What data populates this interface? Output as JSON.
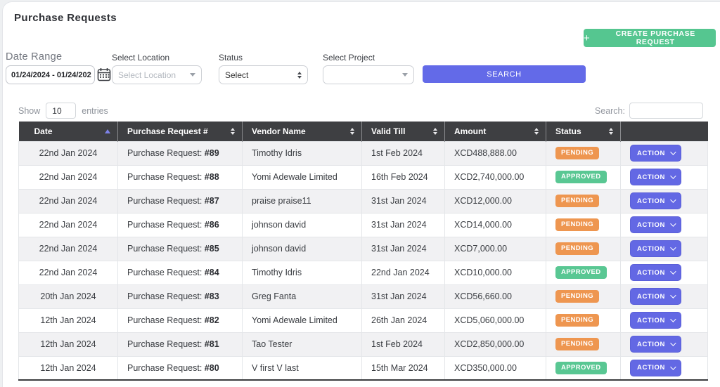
{
  "header": {
    "title": "Purchase Requests",
    "create_button_label": "CREATE PURCHASE REQUEST",
    "create_button_icon": "+"
  },
  "filters": {
    "date_range": {
      "label": "Date Range",
      "value": "01/24/2024 - 01/24/202"
    },
    "location": {
      "label": "Select Location",
      "placeholder": "Select Location"
    },
    "status": {
      "label": "Status",
      "value": "Select"
    },
    "project": {
      "label": "Select Project",
      "value": ""
    },
    "search_button_label": "SEARCH"
  },
  "list_controls": {
    "show_label": "Show",
    "entries_value": "10",
    "entries_label": "entries",
    "search_label": "Search:",
    "search_value": ""
  },
  "table": {
    "columns": [
      {
        "key": "date",
        "label": "Date",
        "sort": "asc"
      },
      {
        "key": "request",
        "label": "Purchase Request #",
        "sort": "both"
      },
      {
        "key": "vendor",
        "label": "Vendor Name",
        "sort": "both"
      },
      {
        "key": "valid-till",
        "label": "Valid Till",
        "sort": "both"
      },
      {
        "key": "amount",
        "label": "Amount",
        "sort": "both"
      },
      {
        "key": "status",
        "label": "Status",
        "sort": "both"
      },
      {
        "key": "action",
        "label": "",
        "sort": "none"
      }
    ],
    "action_label": "ACTION",
    "rows": [
      {
        "date": "22nd Jan 2024",
        "request_prefix": "Purchase Request: ",
        "request_no": "#89",
        "vendor": "Timothy Idris",
        "valid_till": "1st Feb 2024",
        "amount": "XCD488,888.00",
        "status": "PENDING"
      },
      {
        "date": "22nd Jan 2024",
        "request_prefix": "Purchase Request: ",
        "request_no": "#88",
        "vendor": "Yomi Adewale Limited",
        "valid_till": "16th Feb 2024",
        "amount": "XCD2,740,000.00",
        "status": "APPROVED"
      },
      {
        "date": "22nd Jan 2024",
        "request_prefix": "Purchase Request: ",
        "request_no": "#87",
        "vendor": "praise praise11",
        "valid_till": "31st Jan 2024",
        "amount": "XCD12,000.00",
        "status": "PENDING"
      },
      {
        "date": "22nd Jan 2024",
        "request_prefix": "Purchase Request: ",
        "request_no": "#86",
        "vendor": "johnson david",
        "valid_till": "31st Jan 2024",
        "amount": "XCD14,000.00",
        "status": "PENDING"
      },
      {
        "date": "22nd Jan 2024",
        "request_prefix": "Purchase Request: ",
        "request_no": "#85",
        "vendor": "johnson david",
        "valid_till": "31st Jan 2024",
        "amount": "XCD7,000.00",
        "status": "PENDING"
      },
      {
        "date": "22nd Jan 2024",
        "request_prefix": "Purchase Request: ",
        "request_no": "#84",
        "vendor": "Timothy Idris",
        "valid_till": "22nd Jan 2024",
        "amount": "XCD10,000.00",
        "status": "APPROVED"
      },
      {
        "date": "20th Jan 2024",
        "request_prefix": "Purchase Request: ",
        "request_no": "#83",
        "vendor": "Greg Fanta",
        "valid_till": "31st Jan 2024",
        "amount": "XCD56,660.00",
        "status": "PENDING"
      },
      {
        "date": "12th Jan 2024",
        "request_prefix": "Purchase Request: ",
        "request_no": "#82",
        "vendor": "Yomi Adewale Limited",
        "valid_till": "26th Jan 2024",
        "amount": "XCD5,060,000.00",
        "status": "PENDING"
      },
      {
        "date": "12th Jan 2024",
        "request_prefix": "Purchase Request: ",
        "request_no": "#81",
        "vendor": "Tao Tester",
        "valid_till": "1st Feb 2024",
        "amount": "XCD2,850,000.00",
        "status": "PENDING"
      },
      {
        "date": "12th Jan 2024",
        "request_prefix": "Purchase Request: ",
        "request_no": "#80",
        "vendor": "V first V last",
        "valid_till": "15th Mar 2024",
        "amount": "XCD350,000.00",
        "status": "APPROVED"
      }
    ]
  },
  "colors": {
    "accent_indigo": "#636AE8",
    "create_green": "#55C690",
    "pending_orange": "#EE9650",
    "approved_green": "#59C793",
    "table_header_bg": "#3E3F42"
  }
}
